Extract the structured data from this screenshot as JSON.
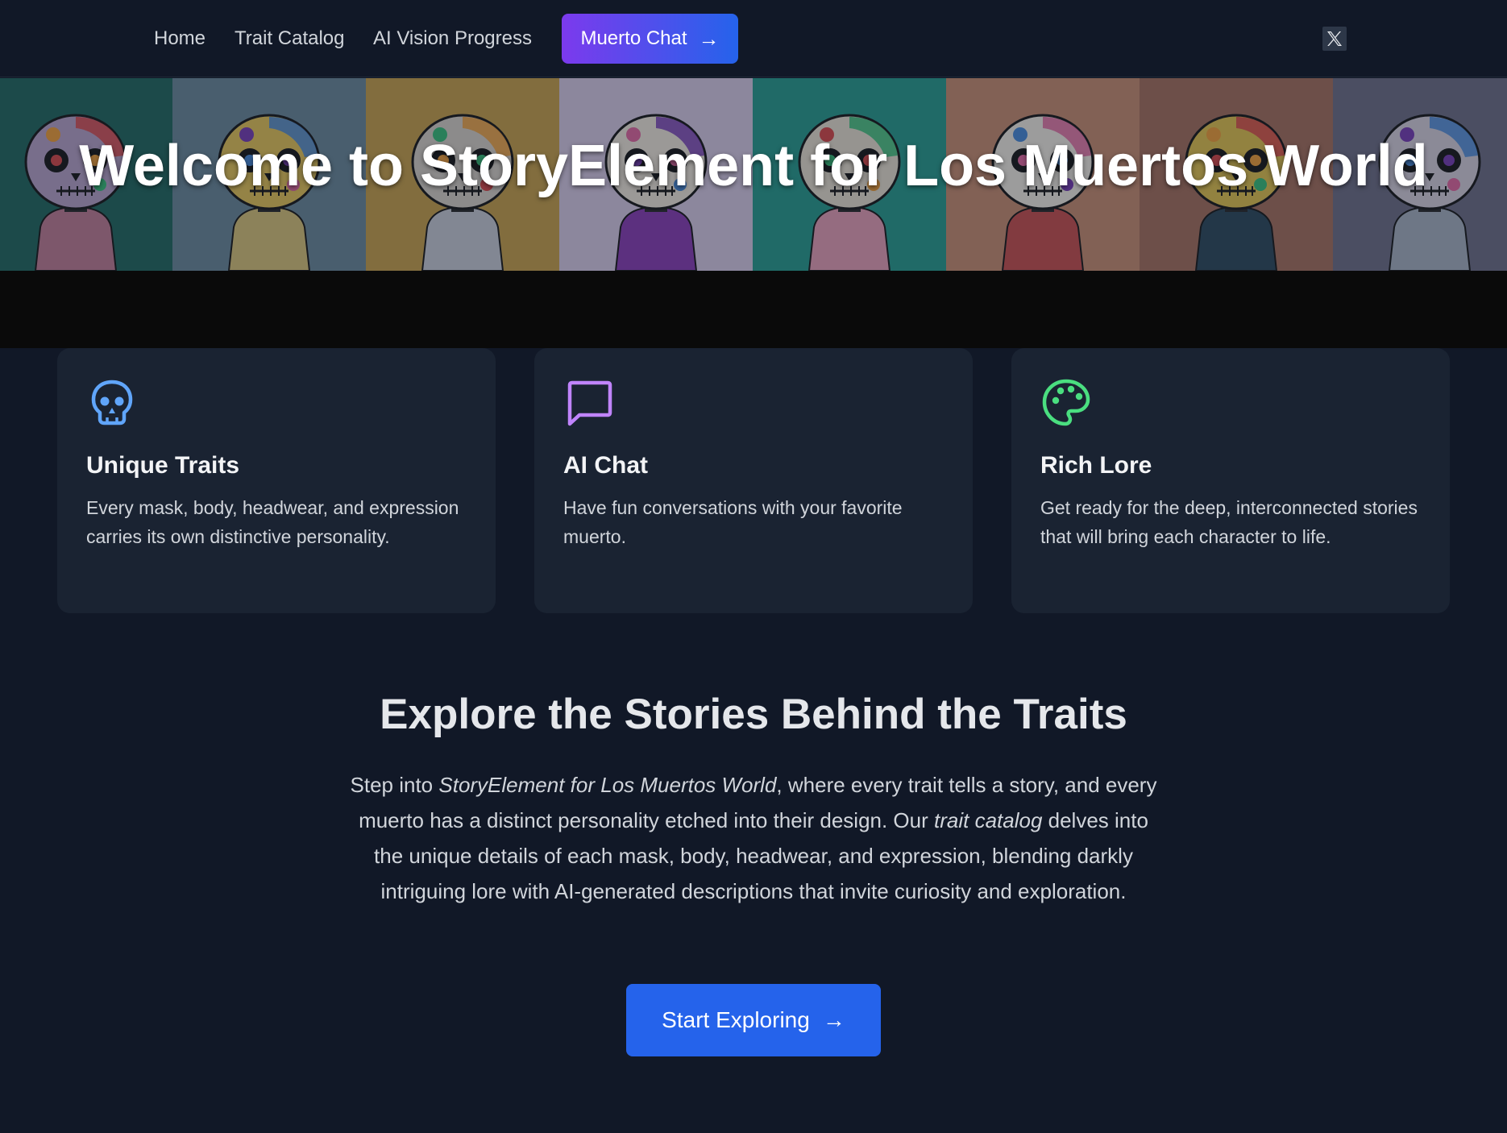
{
  "nav": {
    "links": [
      "Home",
      "Trait Catalog",
      "AI Vision Progress"
    ],
    "chat_button": "Muerto Chat",
    "chat_arrow": "→",
    "social_icon": "x-logo-icon"
  },
  "hero": {
    "title": "Welcome to StoryElement for Los Muertos World",
    "tiles": [
      {
        "bg": "#24695f",
        "hoodie": "#c07f95"
      },
      {
        "bg": "#6c8a9a",
        "hoodie": "#d9c37a"
      },
      {
        "bg": "#c9a24d",
        "hoodie": "#c8ccd6"
      },
      {
        "bg": "#d8cbe6",
        "hoodie": "#8b3fb5"
      },
      {
        "bg": "#2a9d8f",
        "hoodie": "#e7a0b6"
      },
      {
        "bg": "#c98f72",
        "hoodie": "#c9514f"
      },
      {
        "bg": "#a7725e",
        "hoodie": "#2f4b5c"
      },
      {
        "bg": "#707086",
        "hoodie": "#a9b2c0"
      }
    ]
  },
  "features": [
    {
      "icon": "skull-icon",
      "color": "#60a5fa",
      "title": "Unique Traits",
      "text": "Every mask, body, headwear, and expression carries its own distinctive personality."
    },
    {
      "icon": "chat-bubble-icon",
      "color": "#c084fc",
      "title": "AI Chat",
      "text": "Have fun conversations with your favorite muerto."
    },
    {
      "icon": "palette-icon",
      "color": "#4ade80",
      "title": "Rich Lore",
      "text": "Get ready for the deep, interconnected stories that will bring each character to life."
    }
  ],
  "explore": {
    "title": "Explore the Stories Behind the Traits",
    "text_1": "Step into ",
    "text_em_1": "StoryElement for Los Muertos World",
    "text_2": ", where every trait tells a story, and every muerto has a distinct personality etched into their design. Our ",
    "text_em_2": "trait catalog",
    "text_3": " delves into the unique details of each mask, body, headwear, and expression, blending darkly intriguing lore with AI-generated descriptions that invite curiosity and exploration.",
    "cta_label": "Start Exploring",
    "cta_arrow": "→"
  },
  "colors": {
    "page_bg": "#111827",
    "card_bg": "#1a2332",
    "accent_blue": "#2563eb",
    "accent_purple": "#7c3aed"
  }
}
